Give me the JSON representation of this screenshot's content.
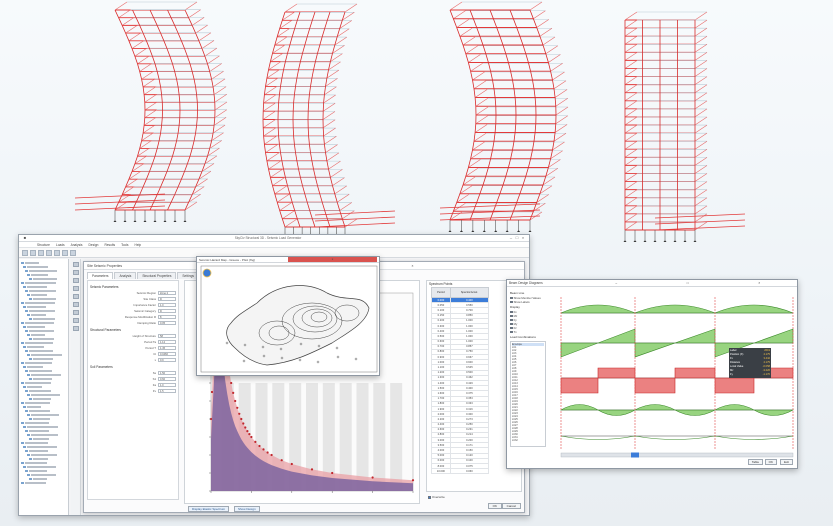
{
  "main_window": {
    "title": "SkyCiv Structural 3D - Seismic Load Generator",
    "menu": [
      "Structure",
      "Loads",
      "Analysis",
      "Design",
      "Results",
      "Tools",
      "Help"
    ],
    "dialog": {
      "title": "Site Seismic Properties",
      "tabs": [
        "Parameters",
        "Analysis",
        "Structural Properties",
        "Settings"
      ],
      "param_sections": [
        {
          "heading": "Seismic Parameters",
          "rows": [
            {
              "label": "Seismic Region",
              "value": "Zone 2"
            },
            {
              "label": "Site Class",
              "value": "D"
            },
            {
              "label": "Importance Factor",
              "value": "1.0"
            },
            {
              "label": "Seismic Category",
              "value": "D"
            },
            {
              "label": "Response Modification R",
              "value": "8"
            },
            {
              "label": "Damping Ratio",
              "value": "0.05"
            }
          ]
        },
        {
          "heading": "Structural Parameters",
          "rows": [
            {
              "label": "Height of Structure",
              "value": "58"
            },
            {
              "label": "Period Ta",
              "value": "1.12"
            },
            {
              "label": "Period T",
              "value": "1.45"
            },
            {
              "label": "Ct",
              "value": "0.0466"
            },
            {
              "label": "x",
              "value": "0.9"
            }
          ]
        },
        {
          "heading": "Soil Parameters",
          "rows": [
            {
              "label": "Ss",
              "value": "1.50"
            },
            {
              "label": "S1",
              "value": "0.60"
            },
            {
              "label": "Fa",
              "value": "1.0"
            },
            {
              "label": "Fv",
              "value": "1.5"
            }
          ]
        }
      ],
      "spectrum_table": {
        "title": "Spectrum Points",
        "headers": [
          "Period",
          "Spectral Accel."
        ],
        "rows": [
          [
            "0.000",
            "0.400"
          ],
          [
            "0.050",
            "0.550"
          ],
          [
            "0.100",
            "0.700"
          ],
          [
            "0.150",
            "0.850"
          ],
          [
            "0.200",
            "1.000"
          ],
          [
            "0.300",
            "1.000"
          ],
          [
            "0.400",
            "1.000"
          ],
          [
            "0.500",
            "1.000"
          ],
          [
            "0.600",
            "1.000"
          ],
          [
            "0.700",
            "0.857"
          ],
          [
            "0.800",
            "0.750"
          ],
          [
            "0.900",
            "0.667"
          ],
          [
            "1.000",
            "0.600"
          ],
          [
            "1.100",
            "0.545"
          ],
          [
            "1.200",
            "0.500"
          ],
          [
            "1.300",
            "0.462"
          ],
          [
            "1.400",
            "0.429"
          ],
          [
            "1.500",
            "0.400"
          ],
          [
            "1.600",
            "0.375"
          ],
          [
            "1.700",
            "0.353"
          ],
          [
            "1.800",
            "0.333"
          ],
          [
            "1.900",
            "0.316"
          ],
          [
            "2.000",
            "0.300"
          ],
          [
            "2.200",
            "0.273"
          ],
          [
            "2.400",
            "0.250"
          ],
          [
            "2.600",
            "0.231"
          ],
          [
            "2.800",
            "0.214"
          ],
          [
            "3.000",
            "0.200"
          ],
          [
            "3.500",
            "0.171"
          ],
          [
            "4.000",
            "0.150"
          ],
          [
            "5.000",
            "0.120"
          ],
          [
            "6.000",
            "0.100"
          ],
          [
            "8.000",
            "0.075"
          ],
          [
            "10.000",
            "0.060"
          ]
        ],
        "selected_row": 0
      },
      "overwrite_label": "Overwrite",
      "buttons": {
        "ok": "OK",
        "cancel": "Cancel"
      },
      "spectrum_buttons": {
        "show_spectrum": "Display Elastic Spectrum",
        "show_design": "Show Design"
      }
    }
  },
  "map_window": {
    "title": "Seismic Hazard Map - Greece - PGA (%g)",
    "close": "x"
  },
  "beam_window": {
    "title": "Beam Design Diagrams",
    "heading_view": "Beam Line",
    "options": [
      {
        "label": "Show Member Values",
        "checked": true
      },
      {
        "label": "Show Labels",
        "checked": true
      }
    ],
    "heading_display": "Display",
    "display_options": [
      {
        "label": "Fx",
        "checked": true
      },
      {
        "label": "Mz",
        "checked": true
      },
      {
        "label": "Fy",
        "checked": true
      },
      {
        "label": "My",
        "checked": false
      },
      {
        "label": "Fz",
        "checked": false
      },
      {
        "label": "Tx",
        "checked": false
      }
    ],
    "combo_heading": "Load Combinations",
    "combos": [
      "Envelope",
      "LC1",
      "LC2",
      "LC3",
      "LC4",
      "LC5",
      "LC6",
      "LC7",
      "LC8",
      "LC9",
      "LC10",
      "LC11",
      "LC12",
      "LC13",
      "LC14",
      "LC15",
      "LC16",
      "LC17",
      "LC18",
      "LC19",
      "LC20",
      "LC21",
      "LC22",
      "LC23",
      "LC24",
      "LC25",
      "LC26",
      "LC27",
      "LC28",
      "LC29",
      "LC30",
      "LC31",
      "LC32"
    ],
    "selected_combo": 0,
    "tooltip": [
      {
        "k": "Label",
        "v": "2619"
      },
      {
        "k": "Position (X)",
        "v": "4.175"
      },
      {
        "k": "Fx",
        "v": "3.442"
      },
      {
        "k": "Distance",
        "v": "4.175"
      },
      {
        "k": "Local Value",
        "v": "-0.058"
      },
      {
        "k": "Mz",
        "v": "-3.226"
      },
      {
        "k": "Fy",
        "v": "-1.170"
      }
    ],
    "buttons": {
      "table": "Table",
      "ok": "OK",
      "exit": "Exit"
    }
  }
}
